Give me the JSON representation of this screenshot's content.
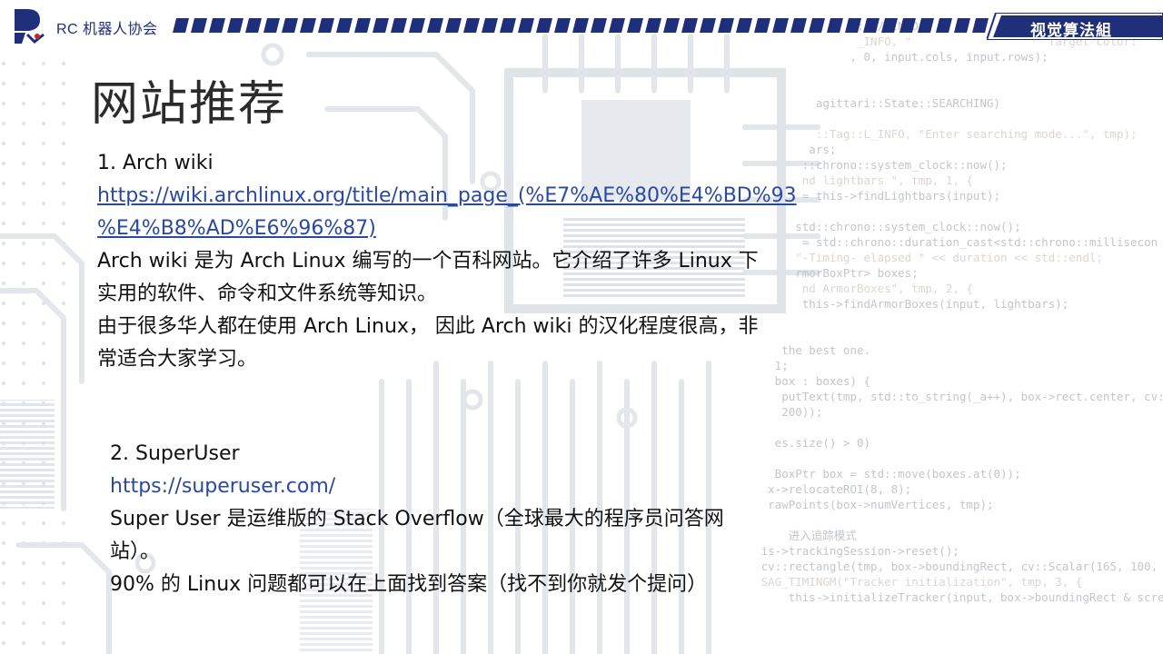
{
  "header": {
    "org_name": "RC 机器人协会",
    "group_name": "视觉算法組",
    "colors": {
      "brand_navy": "#1f2f7a",
      "accent_red": "#c0282d"
    }
  },
  "slide": {
    "title": "网站推荐",
    "items": [
      {
        "heading": "1. Arch wiki",
        "link_line_1": "https://wiki.archlinux.org/title/main_page_(%E7%AE%80%E4%BD%93",
        "link_line_2": "%E4%B8%AD%E6%96%87)",
        "desc_line_1": "Arch wiki 是为 Arch Linux 编写的一个百科网站。它介绍了许多 Linux 下",
        "desc_line_2": "实用的软件、命令和文件系统等知识。",
        "desc_line_3": "由于很多华人都在使用 Arch Linux， 因此 Arch wiki 的汉化程度很高，非",
        "desc_line_4": "常适合大家学习。"
      },
      {
        "heading": "2. SuperUser",
        "link": "https://superuser.com/",
        "desc_line_1": "Super User 是运维版的 Stack Overflow（全球最大的程序员问答网",
        "desc_line_2": "站）。",
        "desc_line_3": "90% 的 Linux 问题都可以在上面找到答案（找不到你就发个提问）"
      }
    ]
  },
  "background_code": {
    "lines": [
      "                  ); // INFO,",
      "                   _INFO, \"                    Target color:",
      "                  , 0, input.cols, input.rows);",
      "",
      "",
      "             agittari::State::SEARCHING)",
      "",
      "             ::Tag::L_INFO, \"Enter searching mode...\", tmp);",
      "            ars;",
      "           ::chrono::system_clock::now();",
      "           nd lightbars \", tmp, 1, {",
      "           = this->findLightbars(input);",
      "",
      "          std::chrono::system_clock::now();",
      "           = std::chrono::duration_cast<std::chrono::millisecon",
      "          \"-Timing- elapsed \" << duration << std::endl;",
      "          rmorBoxPtr> boxes;",
      "           nd ArmorBoxes\", tmp, 2, {",
      "           this->findArmorBoxes(input, lightbars);",
      "",
      "",
      "        the best one.",
      "       1;",
      "       box : boxes) {",
      "        putText(tmp, std::to_string(_a++), box->rect.center, cv::",
      "        200));",
      "",
      "       es.size() > 0)",
      "",
      "       BoxPtr box = std::move(boxes.at(0));",
      "      x->relocateROI(8, 8);",
      "      rawPoints(box->numVertices, tmp);",
      "",
      "         进入追踪模式",
      "     is->trackingSession->reset();",
      "     cv::rectangle(tmp, box->boundingRect, cv::Scalar(165, 100, 18",
      "     SAG_TIMINGM(\"Tracker initialization\", tmp, 3, {",
      "         this->initializeTracker(input, box->boundingRect & screen"
    ]
  }
}
